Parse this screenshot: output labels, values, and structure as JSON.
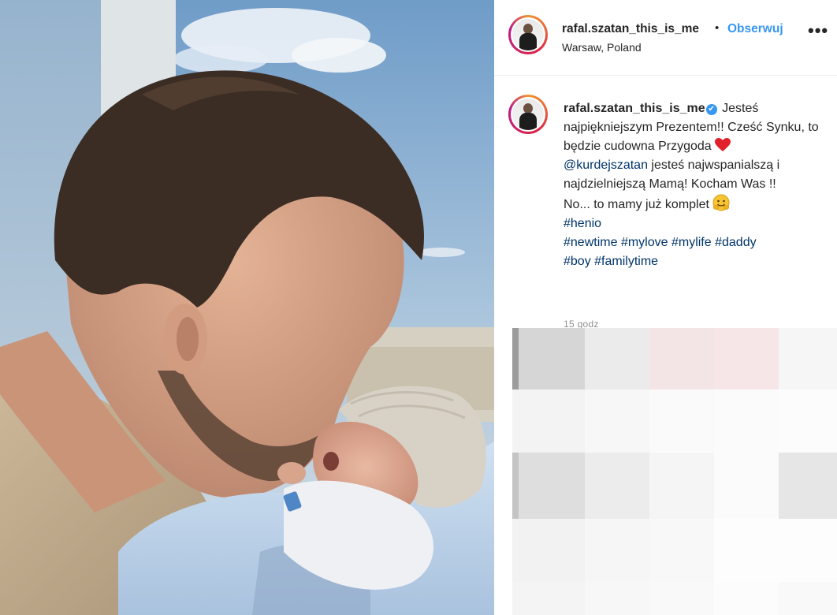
{
  "post": {
    "username": "rafal.szatan_this_is_me",
    "follow_label": "Obserwuj",
    "dot": "•",
    "location": "Warsaw, Poland",
    "more": "•••",
    "verified_icon": "✔",
    "caption": {
      "line1": "Jesteś najpiękniejszym Prezentem!! Cześć Synku, to będzie cudowna Przygoda",
      "mention": "@kurdejszatan",
      "line2": " jesteś najwspanialszą i najdzielniejszą Mamą! Kocham Was !!",
      "line3": "No... to mamy już komplet",
      "tags_line1": "#henio",
      "tags_line2": [
        "#newtime",
        "#mylove",
        "#mylife",
        "#daddy"
      ],
      "tags_line3": [
        "#boy",
        "#familytime"
      ]
    },
    "time": "15 godz"
  },
  "colors": {
    "link_blue": "#3897f0",
    "hashtag": "#003569",
    "text": "#262626",
    "secondary": "#8e8e8e"
  },
  "icons": {
    "heart": "heart-icon",
    "emoji": "hugging-face-emoji",
    "more": "more-options-icon",
    "verified": "verified-badge-icon"
  }
}
